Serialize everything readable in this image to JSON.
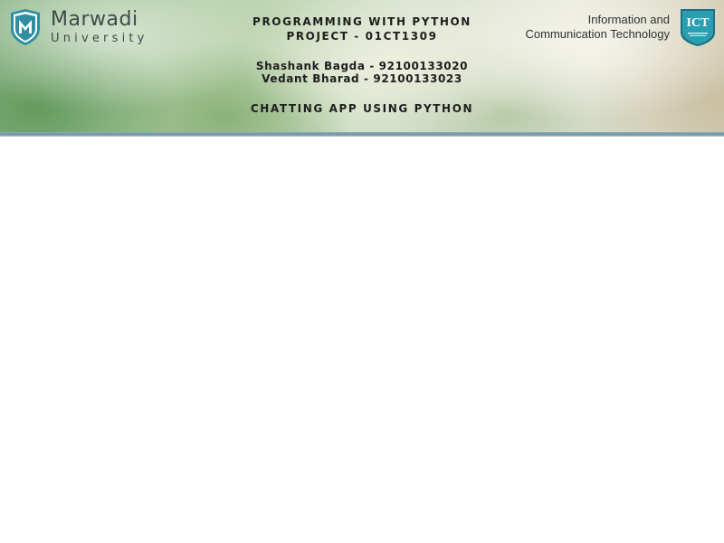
{
  "header": {
    "university": {
      "name": "Marwadi",
      "sub": "University"
    },
    "course_title": "PROGRAMMING WITH PYTHON",
    "course_code": "PROJECT - 01CT1309",
    "members": [
      "Shashank Bagda - 92100133020",
      "Vedant Bharad - 92100133023"
    ],
    "project_title": "CHATTING APP USING PYTHON",
    "department": {
      "line1": "Information and",
      "line2": "Communication Technology",
      "badge": "ICT"
    }
  },
  "colors": {
    "shield_teal": "#2f8fa0",
    "ict_blue": "#2a9fb0"
  }
}
